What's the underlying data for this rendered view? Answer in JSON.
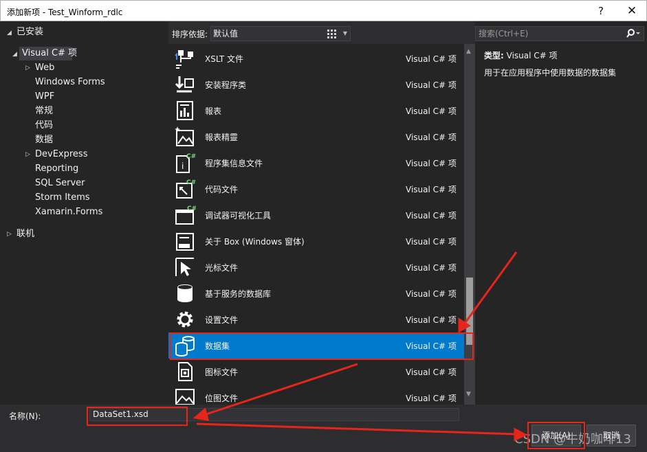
{
  "window": {
    "title": "添加新项 - Test_Winform_rdlc",
    "help_glyph": "?",
    "close_glyph": "✕"
  },
  "tree": {
    "installed": "已安装",
    "visual_csharp": "Visual C# 项",
    "children": [
      "Web",
      "Windows Forms",
      "WPF",
      "常规",
      "代码",
      "数据",
      "DevExpress",
      "Reporting",
      "SQL Server",
      "Storm Items",
      "Xamarin.Forms"
    ],
    "online": "联机"
  },
  "toolbar": {
    "sort_label": "排序依据:",
    "sort_value": "默认值"
  },
  "items": [
    {
      "name": "XSLT 文件",
      "lang": "Visual C# 项",
      "icon": "xslt-icon"
    },
    {
      "name": "安装程序类",
      "lang": "Visual C# 项",
      "icon": "installer-class-icon"
    },
    {
      "name": "報表",
      "lang": "Visual C# 项",
      "icon": "report-icon"
    },
    {
      "name": "報表精靈",
      "lang": "Visual C# 项",
      "icon": "report-wizard-icon"
    },
    {
      "name": "程序集信息文件",
      "lang": "Visual C# 项",
      "icon": "assembly-info-icon"
    },
    {
      "name": "代码文件",
      "lang": "Visual C# 项",
      "icon": "code-file-icon"
    },
    {
      "name": "调试器可视化工具",
      "lang": "Visual C# 项",
      "icon": "debugger-visualizer-icon"
    },
    {
      "name": "关于 Box (Windows 窗体)",
      "lang": "Visual C# 项",
      "icon": "about-box-icon"
    },
    {
      "name": "光标文件",
      "lang": "Visual C# 项",
      "icon": "cursor-file-icon"
    },
    {
      "name": "基于服务的数据库",
      "lang": "Visual C# 项",
      "icon": "service-database-icon"
    },
    {
      "name": "设置文件",
      "lang": "Visual C# 项",
      "icon": "settings-file-icon"
    },
    {
      "name": "数据集",
      "lang": "Visual C# 项",
      "icon": "dataset-icon"
    },
    {
      "name": "图标文件",
      "lang": "Visual C# 项",
      "icon": "icon-file-icon"
    },
    {
      "name": "位图文件",
      "lang": "Visual C# 项",
      "icon": "bitmap-file-icon"
    }
  ],
  "details": {
    "search_placeholder": "搜索(Ctrl+E)",
    "type_label": "类型:",
    "type_value": "Visual C# 项",
    "description": "用于在应用程序中使用数据的数据集"
  },
  "footer": {
    "name_label": "名称(N):",
    "name_value": "DataSet1.xsd",
    "add_label": "添加(A)",
    "cancel_label": "取消"
  },
  "watermark": "CSDN @牛奶咖啡13",
  "colors": {
    "accent": "#007acc",
    "annotation_red": "#e8251b"
  }
}
